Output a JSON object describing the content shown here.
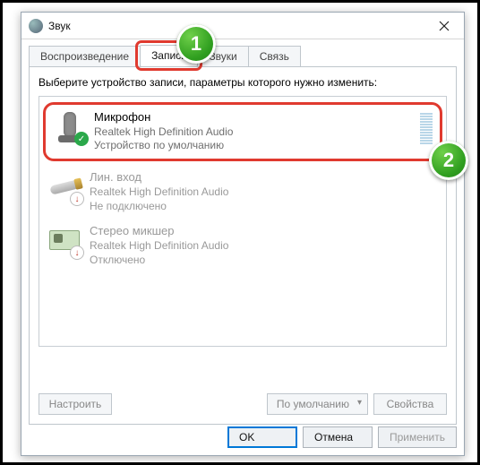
{
  "window": {
    "title": "Звук"
  },
  "tabs": {
    "playback": "Воспроизведение",
    "recording": "Запись",
    "sounds": "Звуки",
    "comm": "Связь"
  },
  "instruction": "Выберите устройство записи, параметры которого нужно изменить:",
  "devices": [
    {
      "name": "Микрофон",
      "sub": "Realtek High Definition Audio",
      "status": "Устройство по умолчанию"
    },
    {
      "name": "Лин. вход",
      "sub": "Realtek High Definition Audio",
      "status": "Не подключено"
    },
    {
      "name": "Стерео микшер",
      "sub": "Realtek High Definition Audio",
      "status": "Отключено"
    }
  ],
  "panel_buttons": {
    "configure": "Настроить",
    "set_default": "По умолчанию",
    "properties": "Свойства"
  },
  "dialog_buttons": {
    "ok": "OK",
    "cancel": "Отмена",
    "apply": "Применить"
  },
  "badges": {
    "one": "1",
    "two": "2"
  }
}
